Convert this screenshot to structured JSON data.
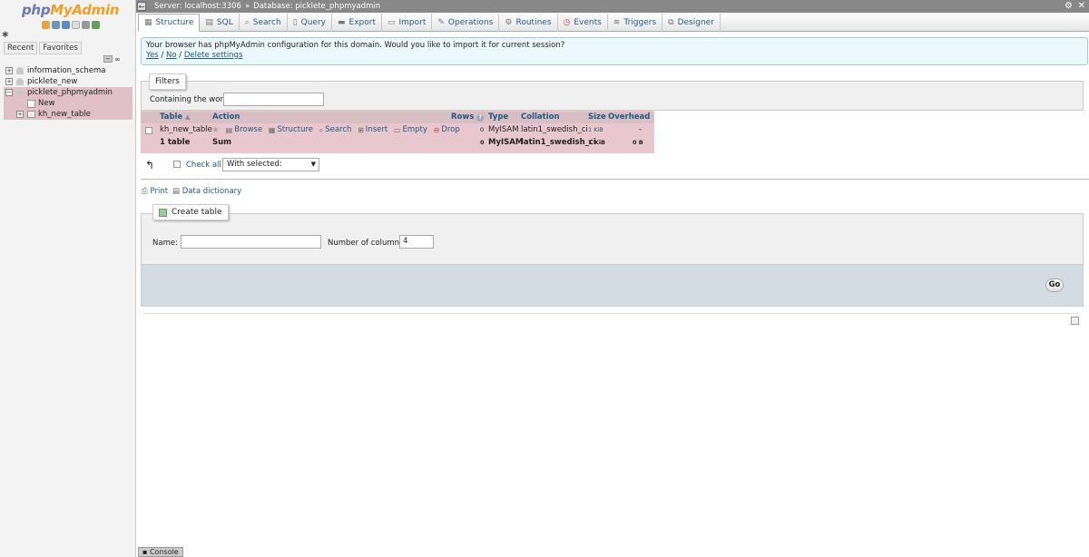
{
  "logo": {
    "php": "php",
    "myadmin": "MyAdmin"
  },
  "nav": {
    "tabs": [
      "Recent",
      "Favorites"
    ],
    "tree": [
      {
        "label": "information_schema"
      },
      {
        "label": "picklete_new"
      },
      {
        "label": "picklete_phpmyadmin"
      },
      {
        "label": "New"
      },
      {
        "label": "kh_new_table"
      }
    ]
  },
  "topbar": {
    "server": "Server: localhost:3306",
    "sep": "»",
    "database": "Database: picklete_phpmyadmin"
  },
  "tabs": [
    "Structure",
    "SQL",
    "Search",
    "Query",
    "Export",
    "Import",
    "Operations",
    "Routines",
    "Events",
    "Triggers",
    "Designer"
  ],
  "notice": {
    "text": "Your browser has phpMyAdmin configuration for this domain. Would you like to import it for current session?",
    "yes": "Yes",
    "no": "No",
    "delete": "Delete settings",
    "slash": "/"
  },
  "filters": {
    "legend": "Filters",
    "label": "Containing the word:"
  },
  "table": {
    "headers": {
      "table": "Table",
      "action": "Action",
      "rows": "Rows",
      "type": "Type",
      "collation": "Collation",
      "size": "Size",
      "overhead": "Overhead"
    },
    "rows": [
      {
        "name": "kh_new_table",
        "rows": "0",
        "type": "MyISAM",
        "collation": "latin1_swedish_ci",
        "size": "1 KiB",
        "overhead": "-"
      }
    ],
    "actions": [
      "Browse",
      "Structure",
      "Search",
      "Insert",
      "Empty",
      "Drop"
    ],
    "sum": {
      "name": "1 table",
      "label": "Sum",
      "rows": "0",
      "type": "MyISAM",
      "collation": "latin1_swedish_ci",
      "size": "1 KiB",
      "overhead": "0 B"
    }
  },
  "checkall": {
    "label": "Check all",
    "with_selected": "With selected:"
  },
  "links": {
    "print": "Print",
    "dict": "Data dictionary"
  },
  "create": {
    "legend": "Create table",
    "name_label": "Name:",
    "cols_label": "Number of columns:",
    "cols_value": "4",
    "go": "Go"
  },
  "console": "Console"
}
